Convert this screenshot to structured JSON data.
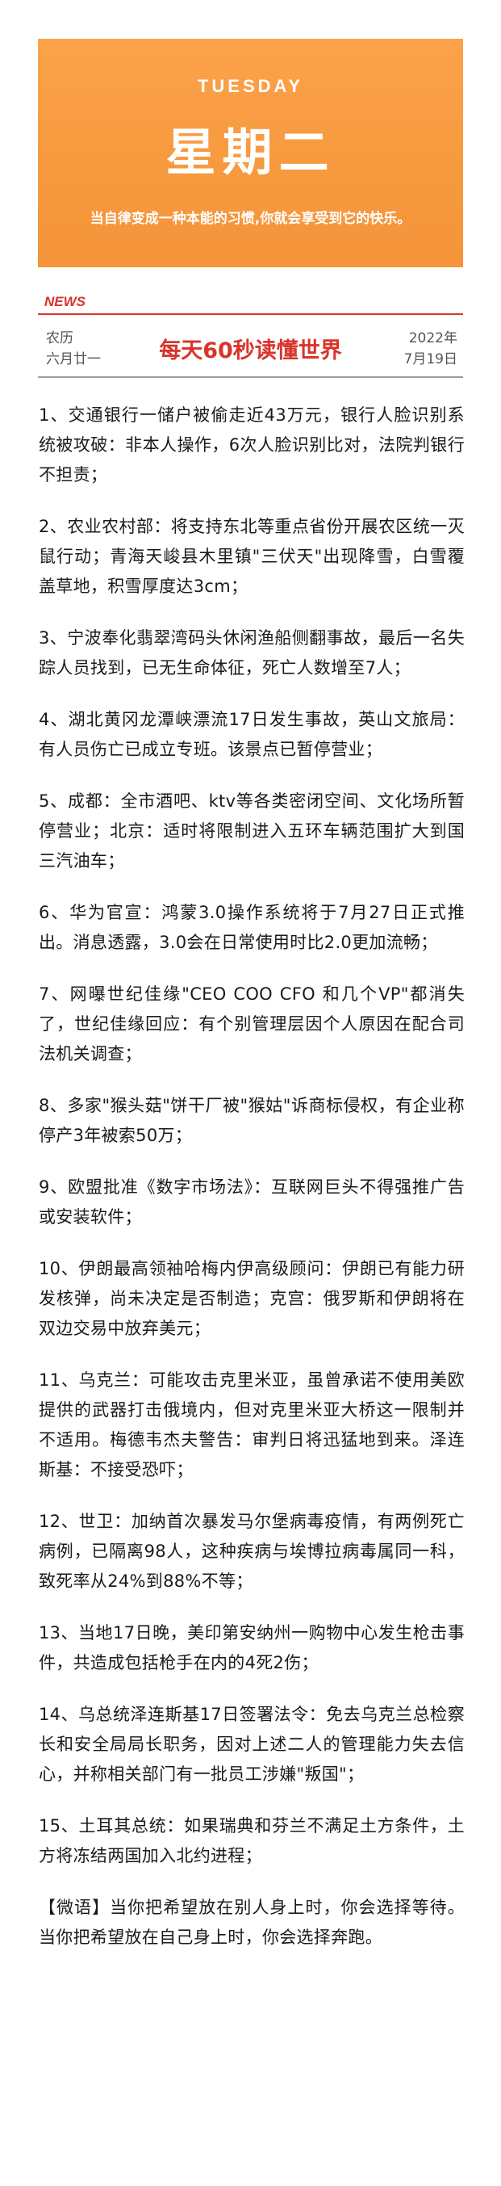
{
  "banner": {
    "day_en": "TUESDAY",
    "day_cn": "星期二",
    "motto": "当自律变成一种本能的习惯,你就会享受到它的快乐。"
  },
  "header": {
    "tag": "NEWS",
    "lunar_label": "农历",
    "lunar_date": "六月廿一",
    "masthead": "每天60秒读懂世界",
    "year": "2022年",
    "date": "7月19日"
  },
  "colors": {
    "banner_orange": "#f79a3f",
    "accent_red": "#d9342b"
  },
  "items": [
    "1、交通银行一储户被偷走近43万元，银行人脸识别系统被攻破：非本人操作，6次人脸识别比对，法院判银行不担责；",
    "2、农业农村部：将支持东北等重点省份开展农区统一灭鼠行动；青海天峻县木里镇\"三伏天\"出现降雪，白雪覆盖草地，积雪厚度达3cm；",
    "3、宁波奉化翡翠湾码头休闲渔船侧翻事故，最后一名失踪人员找到，已无生命体征，死亡人数增至7人；",
    "4、湖北黄冈龙潭峡漂流17日发生事故，英山文旅局：有人员伤亡已成立专班。该景点已暂停营业；",
    "5、成都：全市酒吧、ktv等各类密闭空间、文化场所暂停营业；北京：适时将限制进入五环车辆范围扩大到国三汽油车；",
    "6、华为官宣：鸿蒙3.0操作系统将于7月27日正式推出。消息透露，3.0会在日常使用时比2.0更加流畅；",
    "7、网曝世纪佳缘\"CEO COO CFO 和几个VP\"都消失了，世纪佳缘回应：有个别管理层因个人原因在配合司法机关调查；",
    "8、多家\"猴头菇\"饼干厂被\"猴姑\"诉商标侵权，有企业称停产3年被索50万；",
    "9、欧盟批准《数字市场法》：互联网巨头不得强推广告或安装软件；",
    "10、伊朗最高领袖哈梅内伊高级顾问：伊朗已有能力研发核弹，尚未决定是否制造；克宫：俄罗斯和伊朗将在双边交易中放弃美元；",
    "11、乌克兰：可能攻击克里米亚，虽曾承诺不使用美欧提供的武器打击俄境内，但对克里米亚大桥这一限制并不适用。梅德韦杰夫警告：审判日将迅猛地到来。泽连斯基：不接受恐吓；",
    "12、世卫：加纳首次暴发马尔堡病毒疫情，有两例死亡病例，已隔离98人，这种疾病与埃博拉病毒属同一科，致死率从24%到88%不等；",
    "13、当地17日晚，美印第安纳州一购物中心发生枪击事件，共造成包括枪手在内的4死2伤；",
    "14、乌总统泽连斯基17日签署法令：免去乌克兰总检察长和安全局局长职务，因对上述二人的管理能力失去信心，并称相关部门有一批员工涉嫌\"叛国\"；",
    "15、土耳其总统：如果瑞典和芬兰不满足土方条件，土方将冻结两国加入北约进程；",
    "【微语】当你把希望放在别人身上时，你会选择等待。当你把希望放在自己身上时，你会选择奔跑。"
  ]
}
